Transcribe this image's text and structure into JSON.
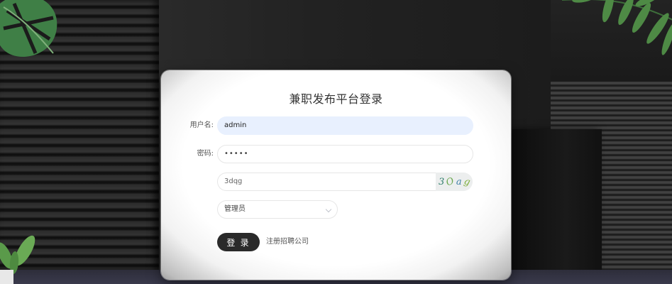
{
  "page": {
    "title": "兼职发布平台登录"
  },
  "form": {
    "username_label": "用户名:",
    "username_value": "admin",
    "password_label": "密码:",
    "password_value": "•••••",
    "captcha_value": "3dqg",
    "captcha_image_text": [
      "3",
      "O",
      "a",
      "g"
    ],
    "role_selected": "管理员",
    "login_label": "登 录",
    "register_label": "注册招聘公司"
  },
  "colors": {
    "button_bg": "#2a2a2a",
    "autofill_bg": "#e8f0fe",
    "captcha_glyphs": [
      "#2e7d6b",
      "#6aa84f",
      "#3d7ea6",
      "#7cae3a"
    ]
  }
}
